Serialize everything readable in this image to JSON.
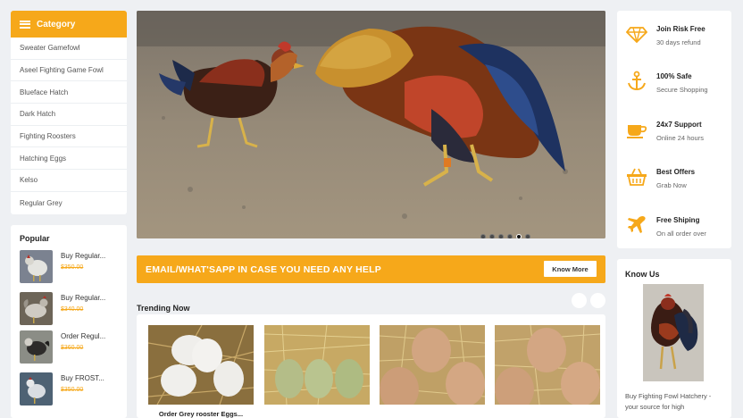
{
  "category": {
    "header_label": "Category",
    "items": [
      "Sweater Gamefowl",
      "Aseel Fighting Game Fowl",
      "Blueface Hatch",
      "Dark Hatch",
      "Fighting Roosters",
      "Hatching Eggs",
      "Kelso",
      "Regular Grey"
    ]
  },
  "popular": {
    "title": "Popular",
    "items": [
      {
        "name": "Buy Regular...",
        "price": "$350.00"
      },
      {
        "name": "Buy Regular...",
        "price": "$340.00"
      },
      {
        "name": "Order Regul...",
        "price": "$360.00"
      },
      {
        "name": "Buy FROST...",
        "price": "$350.00"
      }
    ]
  },
  "hero": {
    "slide_count": 6,
    "active_slide": 5
  },
  "banner": {
    "text": "EMAIL/WHAT'SAPP IN CASE YOU NEED ANY HELP",
    "button_label": "Know More"
  },
  "trending": {
    "title": "Trending Now",
    "items": [
      {
        "name": "Order Grey rooster Eggs..."
      },
      {
        "name": ""
      },
      {
        "name": ""
      },
      {
        "name": ""
      }
    ]
  },
  "features": [
    {
      "icon": "diamond-icon",
      "title": "Join Risk Free",
      "subtitle": "30 days refund"
    },
    {
      "icon": "anchor-icon",
      "title": "100% Safe",
      "subtitle": "Secure Shopping"
    },
    {
      "icon": "coffee-cup-icon",
      "title": "24x7 Support",
      "subtitle": "Online 24 hours"
    },
    {
      "icon": "basket-icon",
      "title": "Best Offers",
      "subtitle": "Grab Now"
    },
    {
      "icon": "airplane-icon",
      "title": "Free Shiping",
      "subtitle": "On all order over"
    }
  ],
  "know_us": {
    "title": "Know Us",
    "text": "Buy Fighting Fowl Hatchery - your source for high"
  },
  "colors": {
    "accent": "#f6a81a",
    "background": "#eef0f3",
    "card": "#ffffff"
  }
}
